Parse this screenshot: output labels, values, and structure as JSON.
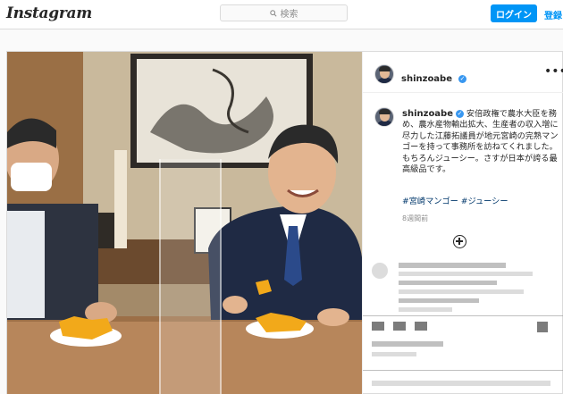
{
  "nav": {
    "logo": "Instagram",
    "search_placeholder": "検索",
    "login_label": "ログイン",
    "signup_label": "登録"
  },
  "post": {
    "username": "shinzoabe",
    "more_icon": "more-horizontal-icon",
    "caption": "安倍政権で農水大臣を務め、農水産物輸出拡大、生産者の収入増に尽力した江藤拓議員が地元宮崎の完熟マンゴーを持って事務所を訪ねてくれました。もちろんジューシー。さすが日本が誇る最高級品です。",
    "hashtags": "#宮崎マンゴー #ジューシー",
    "time_ago": "8週間前"
  },
  "colors": {
    "accent": "#0095f6",
    "verified": "#3897f0",
    "hashtag": "#00376b"
  }
}
